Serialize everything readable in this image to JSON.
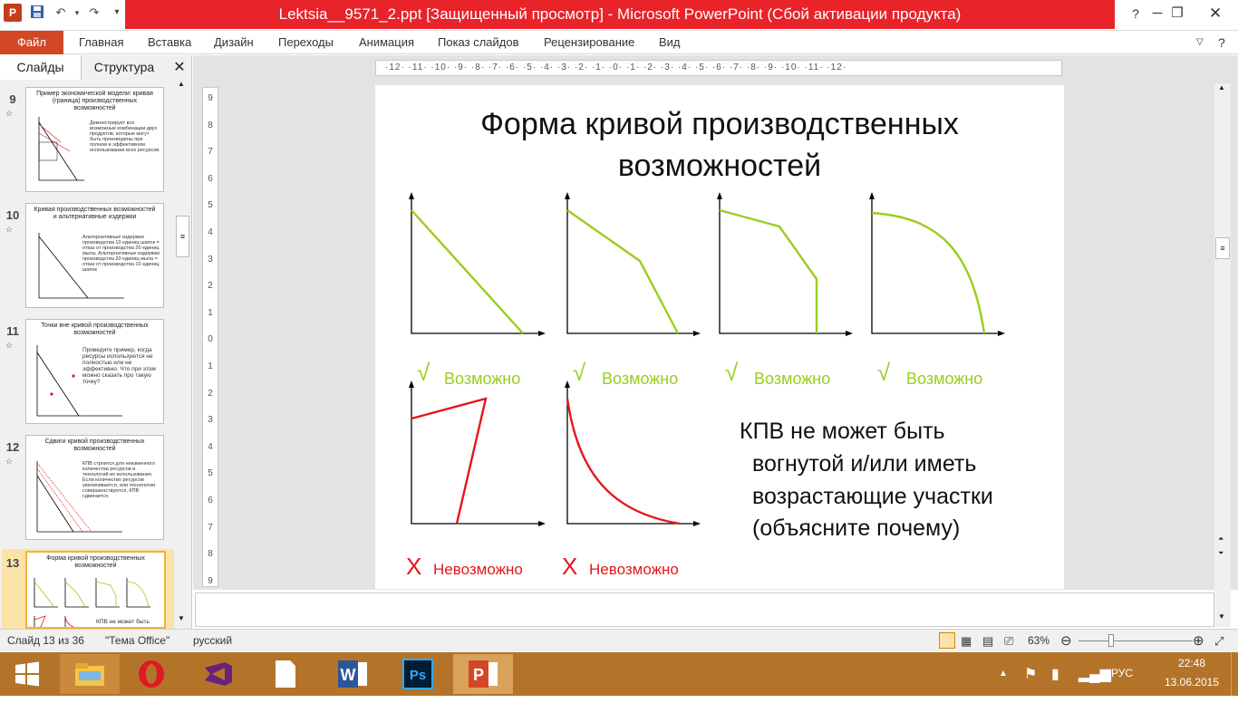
{
  "window": {
    "title": "Lektsia__9571_2.ppt [Защищенный просмотр] - Microsoft PowerPoint (Сбой активации продукта)",
    "app_icon_letter": "P"
  },
  "ribbon": {
    "file": "Файл",
    "tabs": [
      "Главная",
      "Вставка",
      "Дизайн",
      "Переходы",
      "Анимация",
      "Показ слайдов",
      "Рецензирование",
      "Вид"
    ]
  },
  "left_pane": {
    "tab_slides": "Слайды",
    "tab_outline": "Структура",
    "close": "✕",
    "thumbnails": [
      {
        "num": "9",
        "title": "Пример экономической модели: кривая (граница) производственных возможностей",
        "body": "Демонстрирует все возможные комбинации двух продуктов, которые могут быть произведены при полном и эффективном использовании всех ресурсов."
      },
      {
        "num": "10",
        "title": "Кривая производственных возможностей и альтернативные издержки",
        "body": "Альтернативные издержки производства 10 единиц шапок = отказ от производства 20 единиц мыла. Альтернативные издержки производства 20 единиц мыла = отказ от производства 10 единиц шапок"
      },
      {
        "num": "11",
        "title": "Точки вне кривой производственных возможностей",
        "body": "Приведите пример, когда ресурсы используются не полностью или не эффективно. Что при этом можно сказать про такую точку?"
      },
      {
        "num": "12",
        "title": "Сдвиги кривой производственных возможностей",
        "body": "КПВ строится для неизменного количества ресурсов и технологий их использования. Если количество ресурсов увеличивается, или технологии совершенствуются, КПВ сдвигается."
      },
      {
        "num": "13",
        "title": "Форма кривой производственных возможностей",
        "body": "КПВ не может быть"
      }
    ]
  },
  "ruler": {
    "horizontal": "·12· ·11· ·10· ·9· ·8· ·7· ·6· ·5· ·4· ·3· ·2· ·1· ·0· ·1· ·2· ·3· ·4· ·5· ·6· ·7· ·8· ·9· ·10· ·11· ·12·",
    "vertical": [
      "9",
      "8",
      "7",
      "6",
      "5",
      "4",
      "3",
      "2",
      "1",
      "0",
      "1",
      "2",
      "3",
      "4",
      "5",
      "6",
      "7",
      "8",
      "9"
    ]
  },
  "slide": {
    "title_line1": "Форма кривой производственных",
    "title_line2": "возможностей",
    "check_mark": "√",
    "possible_label": "Возможно",
    "x_mark": "X",
    "impossible_label": "Невозможно",
    "note_lines": [
      "КПВ не может быть",
      "вогнутой и/или иметь",
      "возрастающие участки",
      "(объясните почему)"
    ],
    "green": "#9acd1e",
    "red": "#e4161b"
  },
  "statusbar": {
    "slide_info": "Слайд 13 из 36",
    "theme": "\"Тема Office\"",
    "language": "русский",
    "zoom": "63%"
  },
  "taskbar": {
    "lang": "РУС",
    "time": "22:48",
    "date": "13.06.2015"
  }
}
